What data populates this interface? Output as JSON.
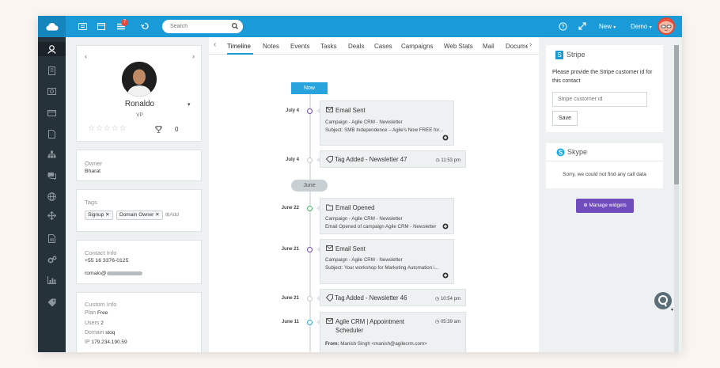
{
  "topbar": {
    "search_placeholder": "Search",
    "notification_count": "7",
    "new_label": "New",
    "demo_label": "Demo"
  },
  "contact": {
    "name": "Ronaldo",
    "title": "VP",
    "score": "0",
    "owner_label": "Owner",
    "owner_value": "Bharat",
    "tags_label": "Tags",
    "tags": [
      "Signup",
      "Domain Owner"
    ],
    "add_tag": "Add",
    "contact_info_label": "Contact Info",
    "phone": "+55 16 3376-0125",
    "email_prefix": "romalo@",
    "custom_info_label": "Custom Info",
    "custom_fields": [
      {
        "label": "Plan",
        "value": "Free"
      },
      {
        "label": "Users",
        "value": "2"
      },
      {
        "label": "Domain",
        "value": "stoq"
      },
      {
        "label": "IP",
        "value": "179.234.190.59"
      }
    ]
  },
  "tabs": [
    "Timeline",
    "Notes",
    "Events",
    "Tasks",
    "Deals",
    "Cases",
    "Campaigns",
    "Web Stats",
    "Mail",
    "Docume"
  ],
  "timeline": {
    "now_label": "Now",
    "june_label": "June",
    "events": [
      {
        "date": "July 4",
        "title": "Email Sent",
        "line1": "Campaign - Agile CRM - Newsletter",
        "line2": "Subject: SMB Independence – Agile's Now FREE for..."
      },
      {
        "date": "July 4",
        "title": "Tag Added - Newsletter 47",
        "time": "11:53 pm"
      },
      {
        "date": "June 22",
        "title": "Email Opened",
        "line1": "Campaign - Agile CRM - Newsletter",
        "line2": "Email Opened of campaign Agile CRM - Newsletter"
      },
      {
        "date": "June 21",
        "title": "Email Sent",
        "line1": "Campaign - Agile CRM - Newsletter",
        "line2": "Subject: Your workshop for Marketing Automation i..."
      },
      {
        "date": "June 21",
        "title": "Tag Added - Newsletter 46",
        "time": "10:54 pm"
      },
      {
        "date": "June 11",
        "title": "Agile CRM | Appointment",
        "title2": "Scheduler",
        "time": "05:39 am",
        "from_label": "From:",
        "from": "Manish Singh <manish@agilecrm.com>"
      }
    ]
  },
  "stripe": {
    "title": "Stripe",
    "description": "Please provide the Stripe customer id for this contact",
    "input_placeholder": "Stripe customer id",
    "save_label": "Save"
  },
  "skype": {
    "title": "Skype",
    "message": "Sorry, we could not find any call data"
  },
  "manage_widgets_label": "Manage widgets"
}
